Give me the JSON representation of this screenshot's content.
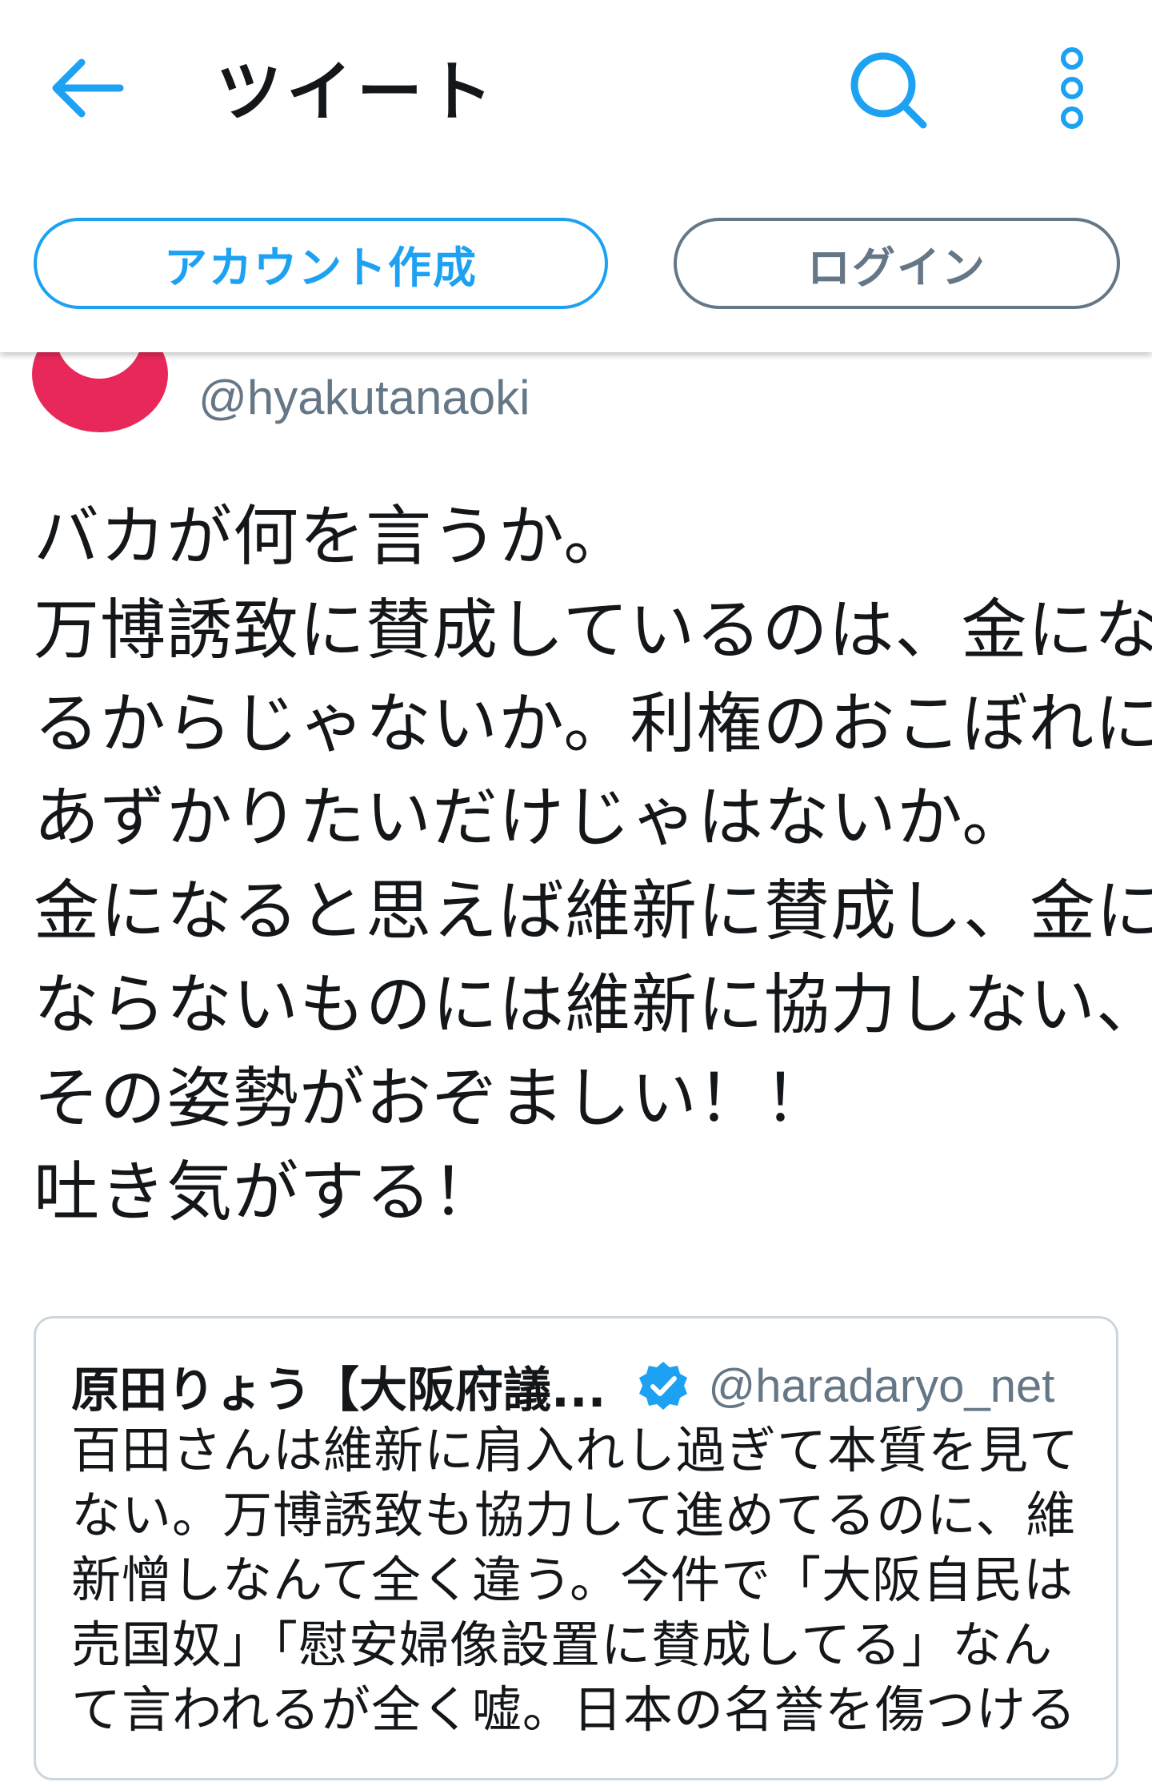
{
  "header": {
    "title": "ツイート",
    "back_icon": "back-arrow-icon",
    "search_icon": "search-icon",
    "more_icon": "more-vertical-icon",
    "accent_color": "#1da1f2"
  },
  "auth": {
    "signup_label": "アカウント作成",
    "login_label": "ログイン"
  },
  "tweet": {
    "handle": "@hyakutanaoki",
    "avatar_color": "#e8285a",
    "lines": [
      "バカが何を言うか。",
      "万博誘致に賛成しているのは、金にな",
      "るからじゃないか。利権のおこぼれに",
      "あずかりたいだけじゃはないか。",
      "金になると思えば維新に賛成し、金に",
      "ならないものには維新に協力しない、",
      "その姿勢がおぞましい！！",
      "吐き気がする！"
    ]
  },
  "quote": {
    "name": "原田りょう【大阪府議...",
    "verified_icon": "verified-badge-icon",
    "handle": "@haradaryo_net",
    "lines": [
      "百田さんは維新に肩入れし過ぎて本質を見て",
      "ない。万博誘致も協力して進めてるのに、維",
      "新憎しなんて全く違う。今件で「大阪自民は",
      "売国奴」「慰安婦像設置に賛成してる」なん",
      "て言われるが全く嘘。日本の名誉を傷つける"
    ]
  }
}
